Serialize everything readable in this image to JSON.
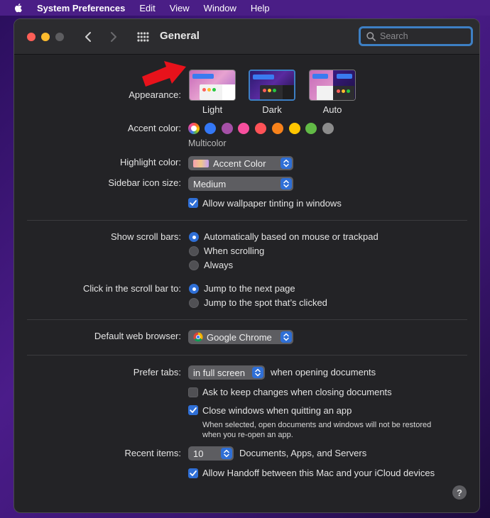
{
  "menubar": {
    "app": "System Preferences",
    "items": [
      "Edit",
      "View",
      "Window",
      "Help"
    ]
  },
  "window": {
    "title": "General",
    "search_placeholder": "Search"
  },
  "appearance": {
    "label": "Appearance:",
    "options": [
      "Light",
      "Dark",
      "Auto"
    ],
    "selected": "Light"
  },
  "accent": {
    "label": "Accent color:",
    "selected_name": "Multicolor",
    "colors": [
      "#3478f6",
      "#a550a7",
      "#f74f9e",
      "#ff5257",
      "#f7821b",
      "#ffc600",
      "#62ba46",
      "#8c8c8c"
    ]
  },
  "highlight": {
    "label": "Highlight color:",
    "value": "Accent Color"
  },
  "sidebar_icon": {
    "label": "Sidebar icon size:",
    "value": "Medium"
  },
  "wallpaper_tint": {
    "label": "Allow wallpaper tinting in windows",
    "checked": true
  },
  "scroll_bars": {
    "label": "Show scroll bars:",
    "options": [
      "Automatically based on mouse or trackpad",
      "When scrolling",
      "Always"
    ],
    "selected_index": 0
  },
  "click_scroll": {
    "label": "Click in the scroll bar to:",
    "options": [
      "Jump to the next page",
      "Jump to the spot that’s clicked"
    ],
    "selected_index": 0
  },
  "browser": {
    "label": "Default web browser:",
    "value": "Google Chrome"
  },
  "tabs": {
    "label": "Prefer tabs:",
    "value": "in full screen",
    "suffix": "when opening documents"
  },
  "ask_keep": {
    "label": "Ask to keep changes when closing documents",
    "checked": false
  },
  "close_windows": {
    "label": "Close windows when quitting an app",
    "checked": true,
    "note_line1": "When selected, open documents and windows will not be restored",
    "note_line2": "when you re-open an app."
  },
  "recent": {
    "label": "Recent items:",
    "value": "10",
    "suffix": "Documents, Apps, and Servers"
  },
  "handoff": {
    "label": "Allow Handoff between this Mac and your iCloud devices",
    "checked": true
  },
  "help": "?",
  "colors": {
    "accent_blue": "#2f6fd6",
    "arrow_red": "#e8121b"
  }
}
